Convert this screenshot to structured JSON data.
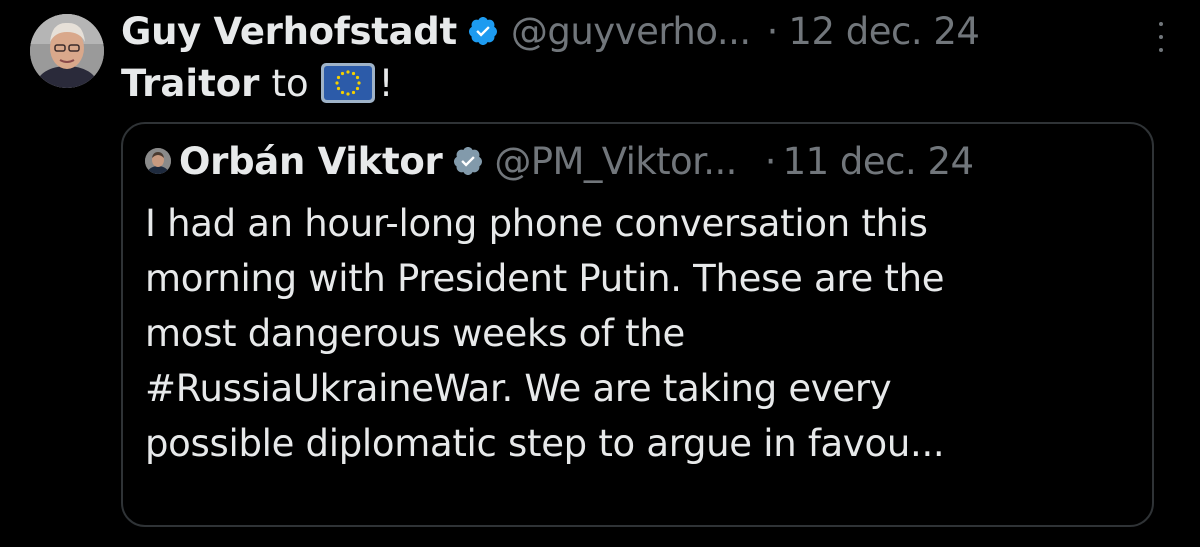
{
  "tweet": {
    "author": {
      "display_name": "Guy Verhofstadt",
      "handle": "@guyverho...",
      "verified_icon": "verified-badge-icon"
    },
    "separator": "·",
    "date": "12 dec. 24",
    "more_icon": "more-vertical-icon",
    "text": {
      "bold": "Traitor",
      "plain": "to",
      "flag_icon": "eu-flag-icon",
      "suffix": "!"
    },
    "colors": {
      "background": "#000000",
      "text": "#e7e9ea",
      "muted": "#71767b",
      "verified": "#1d9bf0",
      "border": "#2f3336"
    }
  },
  "quoted_tweet": {
    "author": {
      "display_name": "Orbán Viktor",
      "handle": "@PM_Viktor...",
      "verified_icon": "verified-badge-icon"
    },
    "separator": "·",
    "date": "11 dec. 24",
    "text_lines": [
      "I had an hour-long phone conversation this",
      "morning with President Putin. These are the",
      "most dangerous weeks of the",
      "#RussiaUkraineWar. We are taking every",
      "possible diplomatic step to argue in favou..."
    ]
  }
}
